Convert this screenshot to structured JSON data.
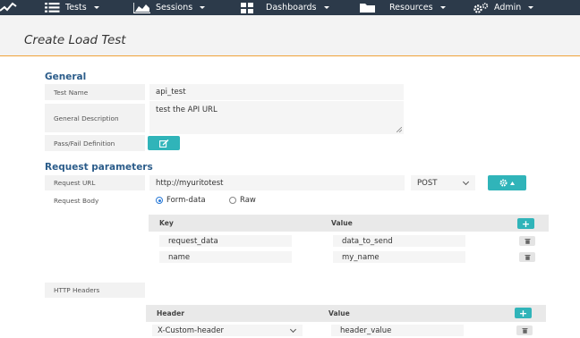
{
  "nav": {
    "tests": "Tests",
    "sessions": "Sessions",
    "dashboards": "Dashboards",
    "resources": "Resources",
    "admin": "Admin"
  },
  "page": {
    "title": "Create Load Test"
  },
  "general": {
    "heading": "General",
    "test_name_label": "Test Name",
    "test_name_value": "api_test",
    "description_label": "General Description",
    "description_value": "test the API URL",
    "passfail_label": "Pass/Fail Definition"
  },
  "request": {
    "heading": "Request parameters",
    "url_label": "Request URL",
    "url_value": "http://myuritotest",
    "method_value": "POST",
    "body_label": "Request Body",
    "body_options": [
      "Form-data",
      "Raw"
    ],
    "body_selected": "Form-data",
    "body_table": {
      "headers": [
        "Key",
        "Value"
      ],
      "rows": [
        {
          "key": "request_data",
          "value": "data_to_send"
        },
        {
          "key": "name",
          "value": "my_name"
        }
      ]
    },
    "http_headers_label": "HTTP Headers",
    "headers_table": {
      "headers": [
        "Header",
        "Value"
      ],
      "rows": [
        {
          "header": "X-Custom-header",
          "value": "header_value"
        }
      ]
    }
  },
  "colors": {
    "navbar": "#2c3a4a",
    "accent": "#30b4b9",
    "heading": "#2b5c8a",
    "divider": "#f0a23a"
  },
  "icons": [
    "logo-icon",
    "list-icon",
    "chart-icon",
    "grid-icon",
    "folder-icon",
    "gears-icon",
    "edit-icon",
    "gear-icon",
    "chevron-down-icon",
    "trash-icon",
    "plus-icon",
    "resize-icon"
  ]
}
